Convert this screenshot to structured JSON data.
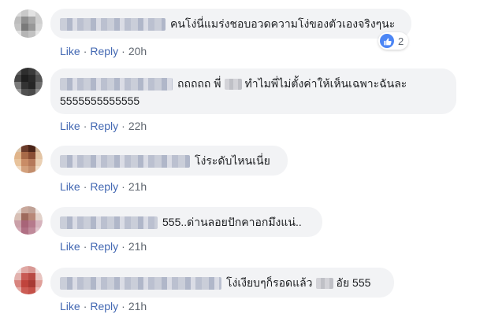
{
  "actions": {
    "like": "Like",
    "reply": "Reply",
    "separator": "·"
  },
  "comments": [
    {
      "text": "คนโง่นี่แมร่งชอบอวดความโง่ของตัวเองจริงๆนะ",
      "time": "20h",
      "reactions": "2"
    },
    {
      "text_a": "ถถถถถ พี่",
      "text_b": "ทำไมพี่ไม่ตั้งค่าให้เห็นเฉพาะฉันละ",
      "text_line2": "5555555555555",
      "time": "22h"
    },
    {
      "text": "โง่ระดับไหนเนี่ย",
      "time": "21h"
    },
    {
      "text": "555..ด่านลอยปักคาอกมึงแน่..",
      "time": "21h"
    },
    {
      "text_a": "โง่เงียบๆก็รอดแล้ว",
      "text_b": "อัย 555",
      "time": "21h"
    }
  ],
  "colors": {
    "link": "#4267b2",
    "bubble": "#f2f3f5",
    "like_badge": "#4c86f5"
  }
}
